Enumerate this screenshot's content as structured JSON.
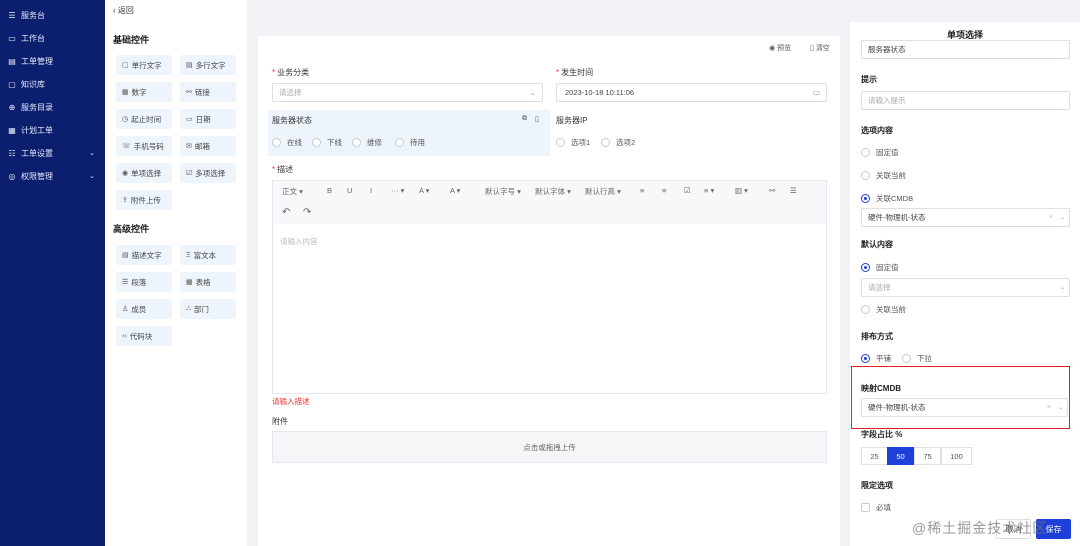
{
  "sidebar": {
    "items": [
      {
        "icon": "☰",
        "label": "服务台",
        "arrow": ""
      },
      {
        "icon": "▭",
        "label": "工作台",
        "arrow": ""
      },
      {
        "icon": "▤",
        "label": "工单管理",
        "arrow": ""
      },
      {
        "icon": "▢",
        "label": "知识库",
        "arrow": ""
      },
      {
        "icon": "⊕",
        "label": "服务目录",
        "arrow": ""
      },
      {
        "icon": "▦",
        "label": "计划工单",
        "arrow": ""
      },
      {
        "icon": "☷",
        "label": "工单设置",
        "arrow": "⌄"
      },
      {
        "icon": "◎",
        "label": "权限管理",
        "arrow": "⌄"
      }
    ]
  },
  "back_label": "返回",
  "palette": {
    "basic_title": "基础控件",
    "basic": [
      {
        "icon": "▢",
        "label": "单行文字"
      },
      {
        "icon": "▤",
        "label": "多行文字"
      },
      {
        "icon": "▦",
        "label": "数字"
      },
      {
        "icon": "⚯",
        "label": "链接"
      },
      {
        "icon": "◷",
        "label": "起止时间"
      },
      {
        "icon": "▭",
        "label": "日期"
      },
      {
        "icon": "☏",
        "label": "手机号码"
      },
      {
        "icon": "✉",
        "label": "邮箱"
      },
      {
        "icon": "◉",
        "label": "单项选择"
      },
      {
        "icon": "☑",
        "label": "多项选择"
      },
      {
        "icon": "⇪",
        "label": "附件上传"
      }
    ],
    "advanced_title": "高级控件",
    "advanced": [
      {
        "icon": "▤",
        "label": "描述文字"
      },
      {
        "icon": "Ξ",
        "label": "富文本"
      },
      {
        "icon": "☰",
        "label": "段落"
      },
      {
        "icon": "▦",
        "label": "表格"
      },
      {
        "icon": "♙",
        "label": "成员"
      },
      {
        "icon": "⛬",
        "label": "部门"
      },
      {
        "icon": "‹›",
        "label": "代码块"
      }
    ]
  },
  "form": {
    "preview": "预览",
    "clear": "清空",
    "category_label": "业务分类",
    "category_placeholder": "请选择",
    "time_label": "发生时间",
    "time_value": "2023-10-18 10:11:06",
    "status_label": "服务器状态",
    "status_options": [
      "在线",
      "下线",
      "维修",
      "待用"
    ],
    "ip_label": "服务器IP",
    "ip_options": [
      "选项1",
      "选项2"
    ],
    "desc_label": "描述",
    "desc_placeholder": "请输入内容",
    "desc_error": "请输入描述",
    "editor_tools": [
      "正文",
      "B",
      "U",
      "I",
      "···",
      "A",
      "A",
      "默认字号",
      "默认字体",
      "默认行高",
      "≡",
      "≡",
      "☑",
      "≡",
      "▥",
      "⚯",
      "☰"
    ],
    "attach_label": "附件",
    "upload_text": "点击或拖拽上传"
  },
  "props": {
    "title": "单项选择",
    "name_value": "服务器状态",
    "hint_label": "提示",
    "hint_placeholder": "请输入提示",
    "options_label": "选项内容",
    "options": [
      "固定值",
      "关联当前",
      "关联CMDB"
    ],
    "options_selected": 2,
    "options_select_value": "硬件-物理机-状态",
    "default_label": "默认内容",
    "default_options": [
      "固定值",
      "关联当前"
    ],
    "default_selected": 0,
    "default_placeholder": "请选择",
    "layout_label": "排布方式",
    "layout_options": [
      "平铺",
      "下拉"
    ],
    "layout_selected": 0,
    "map_label": "映射CMDB",
    "map_value": "硬件-物理机-状态",
    "ratio_label": "字段占比 %",
    "ratios": [
      "25",
      "50",
      "75",
      "100"
    ],
    "ratio_selected": "50",
    "limit_label": "限定选项",
    "required_label": "必填",
    "cancel": "取消",
    "save": "保存"
  },
  "watermark": "@稀土掘金技术社区"
}
